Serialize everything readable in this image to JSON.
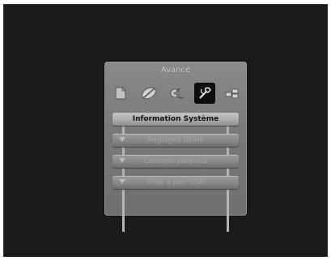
{
  "panel": {
    "title": "Avancé",
    "tabs": [
      {
        "icon": "document-icon",
        "active": false
      },
      {
        "icon": "satellite-icon",
        "active": false
      },
      {
        "icon": "gear-moon-icon",
        "active": false
      },
      {
        "icon": "tools-icon",
        "active": true
      },
      {
        "icon": "grid-icon",
        "active": false
      }
    ],
    "items": [
      {
        "label": "Information Système",
        "selected": true
      },
      {
        "label": "Réglages Usine",
        "selected": false
      },
      {
        "label": "Contrôle parental",
        "selected": false
      },
      {
        "label": "Mise à jour USB",
        "selected": false
      }
    ]
  }
}
